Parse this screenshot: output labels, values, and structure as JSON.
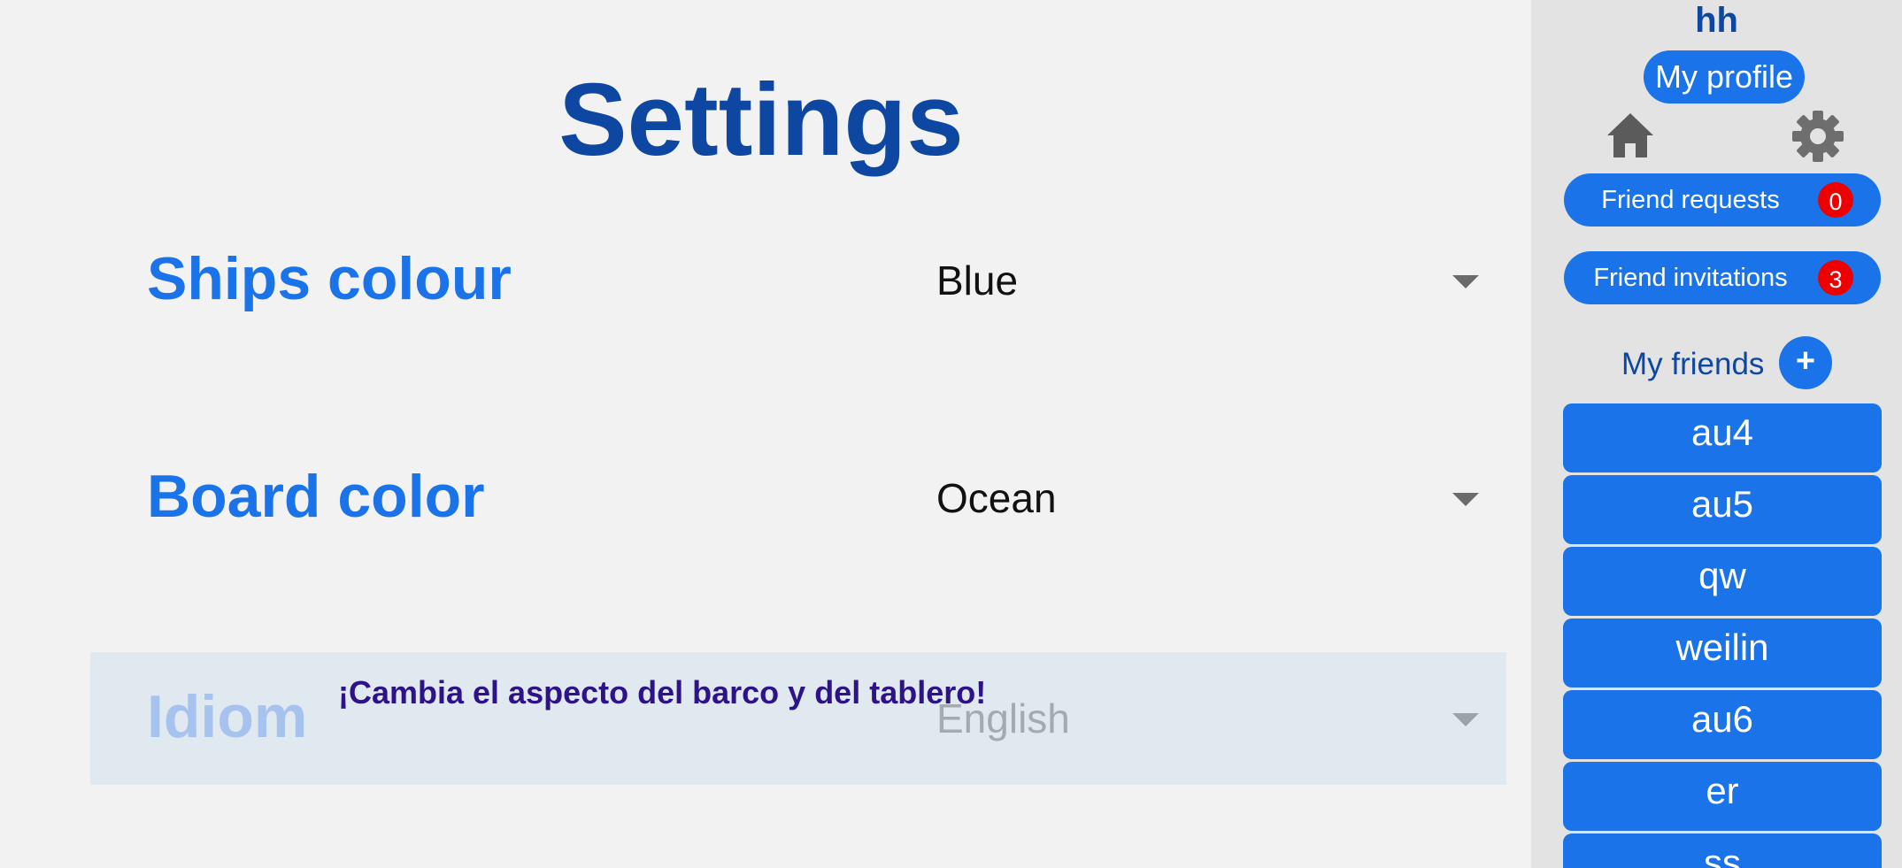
{
  "page": {
    "title": "Settings"
  },
  "settings": {
    "ships_colour": {
      "label": "Ships colour",
      "value": "Blue"
    },
    "board_color": {
      "label": "Board color",
      "value": "Ocean"
    },
    "idiom": {
      "label": "Idiom",
      "value": "English"
    }
  },
  "tooltip": {
    "text": "¡Cambia el aspecto del barco y del tablero!"
  },
  "sidebar": {
    "username": "hh",
    "profile_button": "My profile",
    "friend_requests": {
      "label": "Friend requests",
      "count": "0"
    },
    "friend_invitations": {
      "label": "Friend invitations",
      "count": "3"
    },
    "friends_title": "My friends",
    "add_friend": "+",
    "friends": [
      "au4",
      "au5",
      "qw",
      "weilin",
      "au6",
      "er",
      "ss"
    ]
  },
  "colors": {
    "primary": "#1a73e8",
    "title": "#0d47a1",
    "badge": "#ee0000",
    "tooltip_text": "#2e128a",
    "sidebar_bg": "#e3e3e3",
    "page_bg": "#f2f2f2"
  },
  "icons": {
    "home": "home-icon",
    "settings": "gear-icon"
  }
}
